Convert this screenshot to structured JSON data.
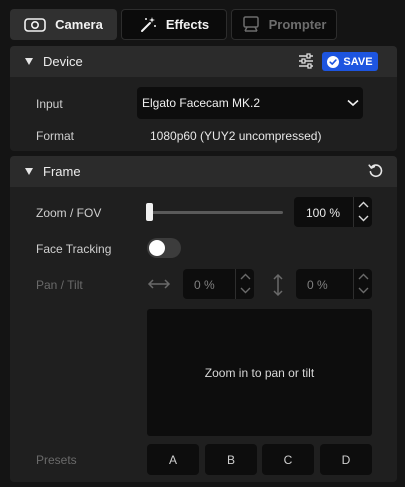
{
  "tabs": [
    {
      "label": "Camera",
      "icon": "camera-icon",
      "state": "active"
    },
    {
      "label": "Effects",
      "icon": "magic-wand-icon",
      "state": "normal"
    },
    {
      "label": "Prompter",
      "icon": "prompter-icon",
      "state": "disabled"
    }
  ],
  "device": {
    "title": "Device",
    "save_label": "SAVE",
    "input_label": "Input",
    "input_value": "Elgato Facecam MK.2",
    "format_label": "Format",
    "format_value": "1080p60 (YUY2 uncompressed)"
  },
  "frame": {
    "title": "Frame",
    "zoom_label": "Zoom / FOV",
    "zoom_value": "100 %",
    "zoom_level": 0,
    "face_tracking_label": "Face Tracking",
    "face_tracking_on": false,
    "pan_tilt_label": "Pan / Tilt",
    "pan_value": "0 %",
    "tilt_value": "0 %",
    "pan_area_text": "Zoom in to pan or tilt",
    "presets_label": "Presets",
    "presets": [
      "A",
      "B",
      "C",
      "D"
    ]
  },
  "colors": {
    "accent": "#1d55e0",
    "background": "#141414",
    "panel": "#1f1f1f",
    "panel_header": "#2b2b2b",
    "field": "#0d0d0d"
  }
}
